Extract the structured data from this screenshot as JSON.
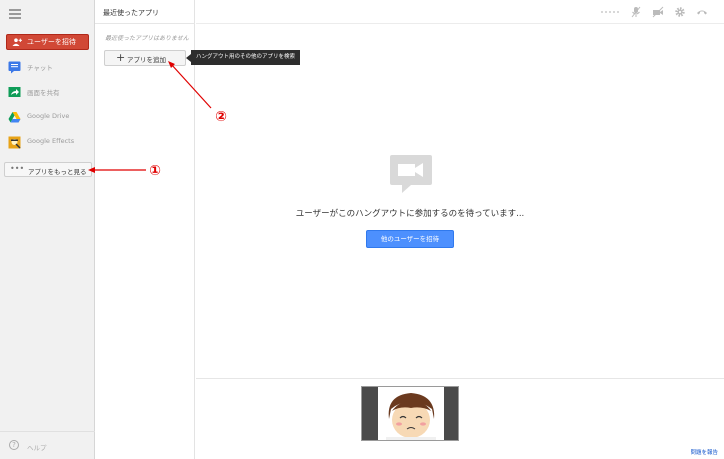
{
  "sidebar": {
    "invite_label": "ユーザーを招待",
    "items": [
      {
        "label": "チャット",
        "icon": "chat-icon"
      },
      {
        "label": "画面を共有",
        "icon": "screen-share-icon"
      },
      {
        "label": "Google Drive",
        "icon": "google-drive-icon"
      },
      {
        "label": "Google Effects",
        "icon": "google-effects-icon"
      }
    ],
    "more_apps_label": "アプリをもっと見る",
    "help_label": "ヘルプ"
  },
  "apps_panel": {
    "title": "最近使ったアプリ",
    "empty_text": "最近使ったアプリはありません",
    "add_app_label": "アプリを追加",
    "tooltip": "ハングアウト用のその他のアプリを検索"
  },
  "main": {
    "waiting_text": "ユーザーがこのハングアウトに参加するのを待っています...",
    "invite_others_label": "他のユーザーを招待",
    "report_link": "問題を報告"
  },
  "annotations": {
    "marker_1": "①",
    "marker_2": "②"
  },
  "colors": {
    "invite_red": "#d14836",
    "primary_blue": "#4d90fe",
    "annotation_red": "#e00000"
  }
}
